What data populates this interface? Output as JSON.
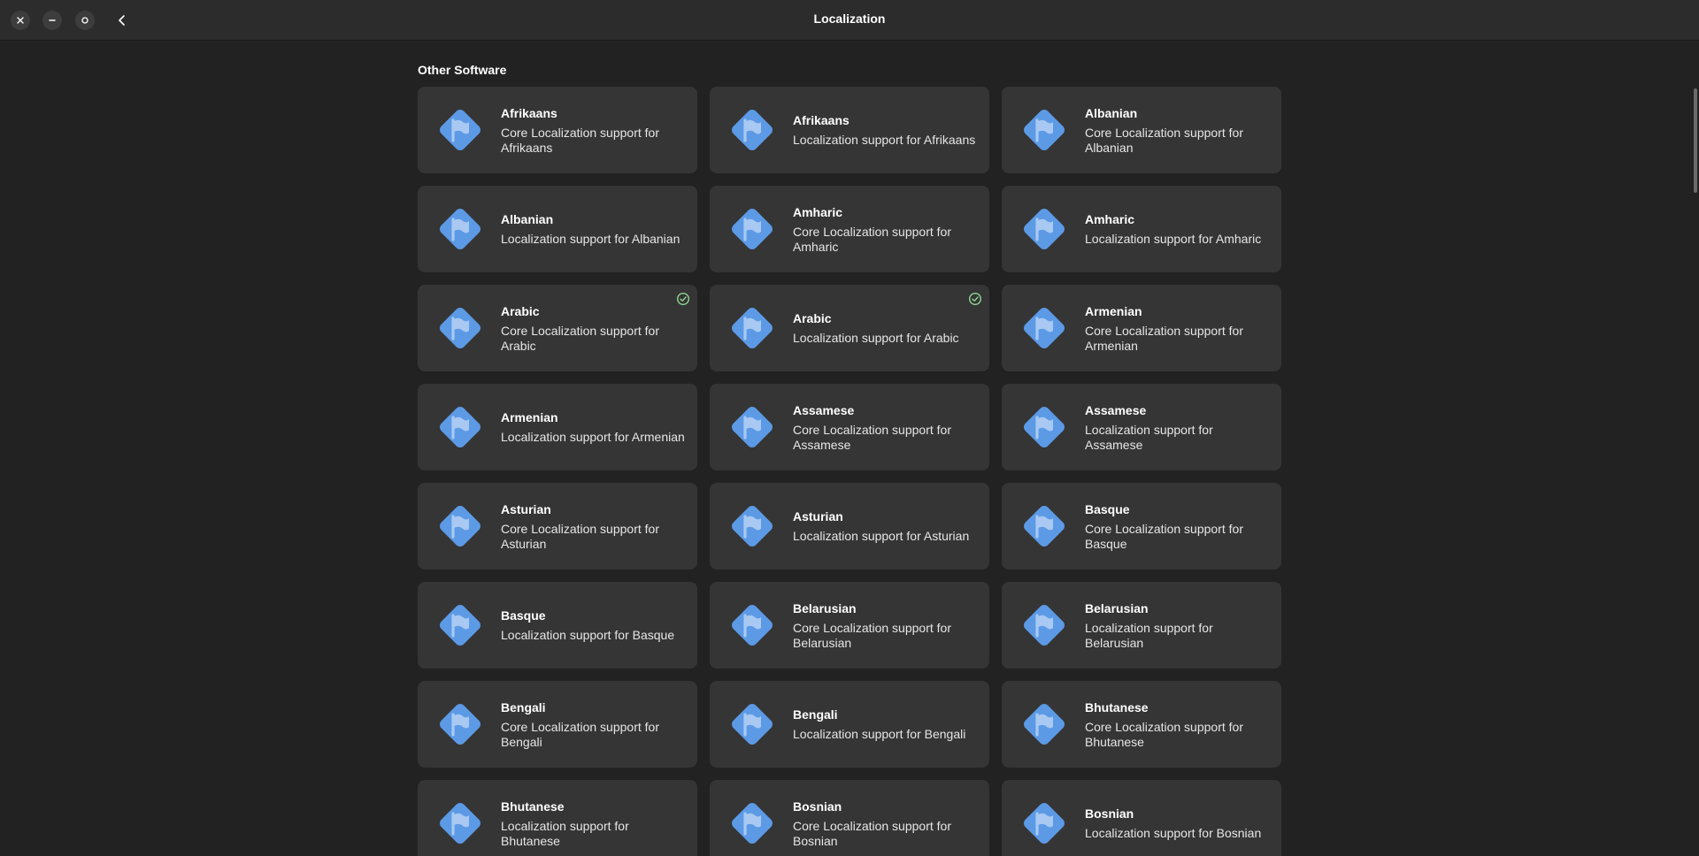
{
  "window": {
    "title": "Localization"
  },
  "section": {
    "title": "Other Software"
  },
  "colors": {
    "icon": "#5c9ae6",
    "icon_glyph": "#a9c9f2",
    "installed": "#8fd694"
  },
  "items": [
    {
      "name": "Afrikaans",
      "desc": "Core Localization support for Afrikaans",
      "installed": false
    },
    {
      "name": "Afrikaans",
      "desc": "Localization support for Afrikaans",
      "installed": false
    },
    {
      "name": "Albanian",
      "desc": "Core Localization support for Albanian",
      "installed": false
    },
    {
      "name": "Albanian",
      "desc": "Localization support for Albanian",
      "installed": false
    },
    {
      "name": "Amharic",
      "desc": "Core Localization support for Amharic",
      "installed": false
    },
    {
      "name": "Amharic",
      "desc": "Localization support for Amharic",
      "installed": false
    },
    {
      "name": "Arabic",
      "desc": "Core Localization support for Arabic",
      "installed": true
    },
    {
      "name": "Arabic",
      "desc": "Localization support for Arabic",
      "installed": true
    },
    {
      "name": "Armenian",
      "desc": "Core Localization support for Armenian",
      "installed": false
    },
    {
      "name": "Armenian",
      "desc": "Localization support for Armenian",
      "installed": false
    },
    {
      "name": "Assamese",
      "desc": "Core Localization support for Assamese",
      "installed": false
    },
    {
      "name": "Assamese",
      "desc": "Localization support for Assamese",
      "installed": false
    },
    {
      "name": "Asturian",
      "desc": "Core Localization support for Asturian",
      "installed": false
    },
    {
      "name": "Asturian",
      "desc": "Localization support for Asturian",
      "installed": false
    },
    {
      "name": "Basque",
      "desc": "Core Localization support for Basque",
      "installed": false
    },
    {
      "name": "Basque",
      "desc": "Localization support for Basque",
      "installed": false
    },
    {
      "name": "Belarusian",
      "desc": "Core Localization support for Belarusian",
      "installed": false
    },
    {
      "name": "Belarusian",
      "desc": "Localization support for Belarusian",
      "installed": false
    },
    {
      "name": "Bengali",
      "desc": "Core Localization support for Bengali",
      "installed": false
    },
    {
      "name": "Bengali",
      "desc": "Localization support for Bengali",
      "installed": false
    },
    {
      "name": "Bhutanese",
      "desc": "Core Localization support for Bhutanese",
      "installed": false
    },
    {
      "name": "Bhutanese",
      "desc": "Localization support for Bhutanese",
      "installed": false
    },
    {
      "name": "Bosnian",
      "desc": "Core Localization support for Bosnian",
      "installed": false
    },
    {
      "name": "Bosnian",
      "desc": "Localization support for Bosnian",
      "installed": false
    }
  ]
}
